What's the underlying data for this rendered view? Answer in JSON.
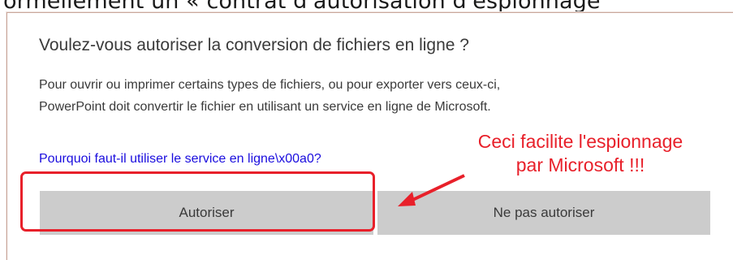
{
  "background_caption": "ormellement un « contrat d'autorisation d'espionnage",
  "dialog": {
    "title": "Voulez-vous autoriser la conversion de fichiers en ligne ?",
    "body_lines": [
      "Pour ouvrir ou imprimer certains types de fichiers, ou pour exporter vers ceux-ci,",
      "PowerPoint doit convertir le fichier en utilisant un service en ligne de Microsoft."
    ],
    "help_link": "Pourquoi faut-il utiliser le service en ligne\\x00a0?",
    "buttons": {
      "allow_label": "Autoriser",
      "deny_label": "Ne pas autoriser"
    }
  },
  "annotation": {
    "lines": [
      "Ceci facilite l'espionnage",
      "par Microsoft !!!"
    ],
    "color": "#e8202a"
  },
  "colors": {
    "button_bg": "#cccccc",
    "link": "#1a0dde",
    "text": "#3a3a3a"
  }
}
